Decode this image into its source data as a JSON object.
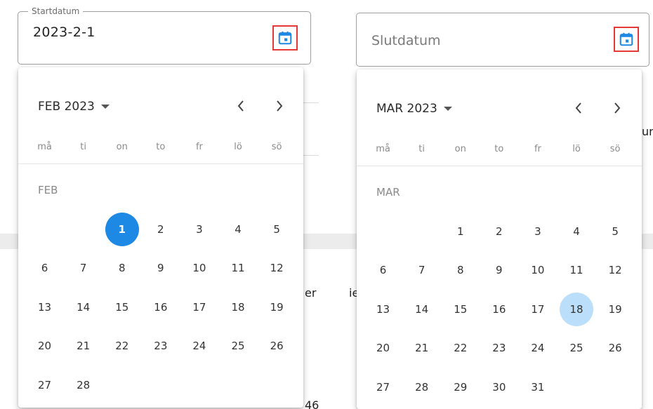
{
  "colors": {
    "accent": "#1e88e5",
    "highlight": "#bbdefb",
    "focus_outline": "#e53935"
  },
  "start": {
    "legend": "Startdatum",
    "value": "2023-2-1",
    "icon": "calendar-icon",
    "calendar": {
      "header": "FEB 2023",
      "month_label": "FEB",
      "weekdays": [
        "må",
        "ti",
        "on",
        "to",
        "fr",
        "lö",
        "sö"
      ],
      "leading_blanks": 2,
      "days": [
        "1",
        "2",
        "3",
        "4",
        "5",
        "6",
        "7",
        "8",
        "9",
        "10",
        "11",
        "12",
        "13",
        "14",
        "15",
        "16",
        "17",
        "18",
        "19",
        "20",
        "21",
        "22",
        "23",
        "24",
        "25",
        "26",
        "27",
        "28"
      ],
      "selected_day": "1"
    }
  },
  "end": {
    "placeholder": "Slutdatum",
    "icon": "calendar-icon",
    "calendar": {
      "header": "MAR 2023",
      "month_label": "MAR",
      "weekdays": [
        "må",
        "ti",
        "on",
        "to",
        "fr",
        "lö",
        "sö"
      ],
      "leading_blanks": 2,
      "days": [
        "1",
        "2",
        "3",
        "4",
        "5",
        "6",
        "7",
        "8",
        "9",
        "10",
        "11",
        "12",
        "13",
        "14",
        "15",
        "16",
        "17",
        "18",
        "19",
        "20",
        "21",
        "22",
        "23",
        "24",
        "25",
        "26",
        "27",
        "28",
        "29",
        "30",
        "31"
      ],
      "highlighted_day": "18"
    }
  },
  "background": {
    "fragment_1": "er",
    "fragment_2": "ie",
    "fragment_3": "ur",
    "fragment_4": "46"
  }
}
